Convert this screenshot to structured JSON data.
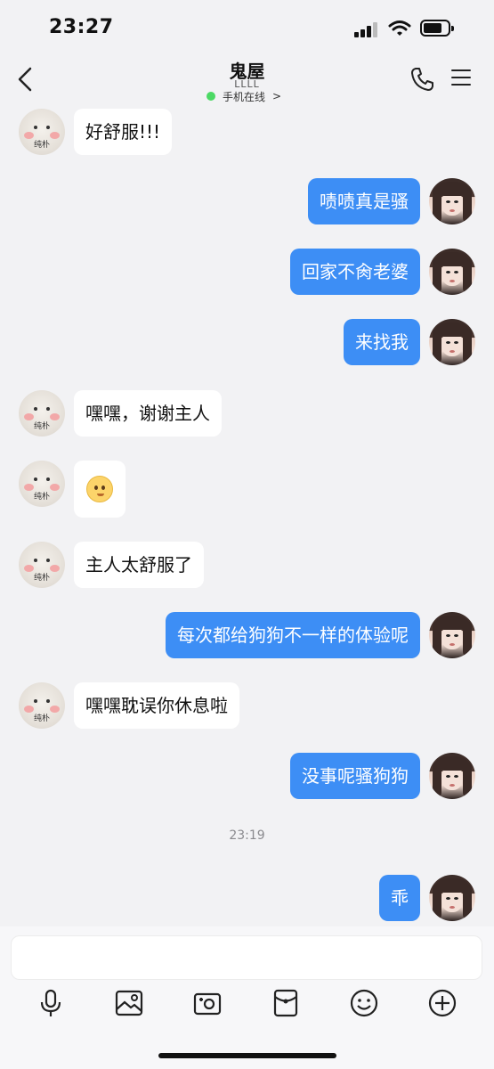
{
  "status_bar": {
    "time": "23:27"
  },
  "header": {
    "title": "鬼屋",
    "subtitle": "LLLL",
    "online_status": "手机在线"
  },
  "avatars": {
    "contact_label": "纯朴"
  },
  "messages": [
    {
      "side": "in",
      "text": "好舒服!!!"
    },
    {
      "side": "out",
      "text": "啧啧真是骚"
    },
    {
      "side": "out",
      "text": "回家不肏老婆"
    },
    {
      "side": "out",
      "text": "来找我"
    },
    {
      "side": "in",
      "text": "嘿嘿，谢谢主人"
    },
    {
      "side": "in",
      "text": "",
      "emoji": "shy-face-emoji"
    },
    {
      "side": "in",
      "text": "主人太舒服了"
    },
    {
      "side": "out",
      "text": "每次都给狗狗不一样的体验呢"
    },
    {
      "side": "in",
      "text": "嘿嘿耽误你休息啦"
    },
    {
      "side": "out",
      "text": "没事呢骚狗狗"
    },
    {
      "side": "out",
      "text": "乖"
    }
  ],
  "timestamp": "23:19",
  "composer": {
    "placeholder": ""
  },
  "toolbar": {
    "icons": [
      "microphone-icon",
      "image-icon",
      "camera-icon",
      "red-packet-icon",
      "emoji-icon",
      "plus-icon"
    ]
  },
  "colors": {
    "outgoing_bubble": "#3d8ef5",
    "incoming_bubble": "#ffffff",
    "background": "#f2f2f4",
    "online_dot": "#4cd964"
  }
}
